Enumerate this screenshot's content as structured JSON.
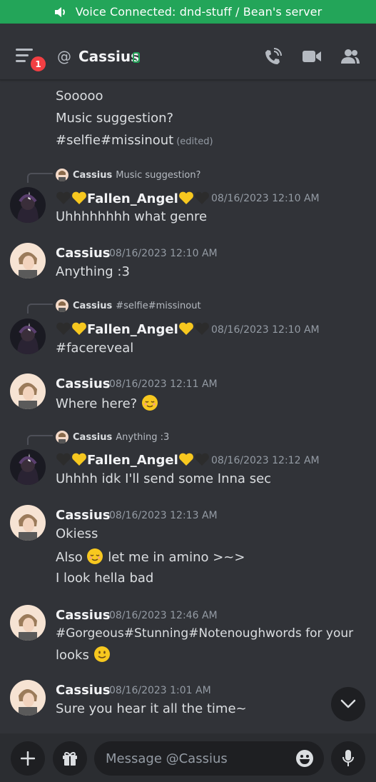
{
  "voice_bar": {
    "text": "Voice Connected: dnd-stuff / Bean's server"
  },
  "header": {
    "title": "Cassius",
    "notification_count": "1",
    "at_symbol": "@"
  },
  "messages": {
    "group0": {
      "lines": [
        "Sooooo",
        "Music suggestion?",
        "#selfie#missinout"
      ],
      "edited": "(edited)"
    },
    "m1": {
      "reply_author": "Cassius",
      "reply_text": "Music suggestion?",
      "author": "Fallen_Angel",
      "time": "08/16/2023 12:10 AM",
      "text": "Uhhhhhhhh what genre"
    },
    "m2": {
      "author": "Cassius",
      "time": "08/16/2023 12:10 AM",
      "text": "Anything :3"
    },
    "m3": {
      "reply_author": "Cassius",
      "reply_text": "#selfie#missinout",
      "author": "Fallen_Angel",
      "time": "08/16/2023 12:10 AM",
      "text": "#facereveal"
    },
    "m4": {
      "author": "Cassius",
      "time": "08/16/2023 12:11 AM",
      "text": "Where here?"
    },
    "m5": {
      "reply_author": "Cassius",
      "reply_text": "Anything :3",
      "author": "Fallen_Angel",
      "time": "08/16/2023 12:12 AM",
      "text": "Uhhhh idk I'll send some Inna sec"
    },
    "m6": {
      "author": "Cassius",
      "time": "08/16/2023 12:13 AM",
      "line1": "Okiess",
      "line2a": "Also",
      "line2b": "let me in amino >~>",
      "line3": "I look hella bad"
    },
    "m7": {
      "author": "Cassius",
      "time": "08/16/2023 12:46 AM",
      "line1": "#Gorgeous#Stunning#Notenoughwords for your",
      "line2": "looks"
    },
    "m8": {
      "author": "Cassius",
      "time": "08/16/2023 1:01 AM",
      "text": "Sure you hear it all the time~"
    }
  },
  "composer": {
    "placeholder": "Message @Cassius"
  },
  "colors": {
    "voice_green": "#23a559",
    "background": "#313338",
    "composer_bg": "#2b2d31",
    "badge_red": "#f23f43"
  }
}
